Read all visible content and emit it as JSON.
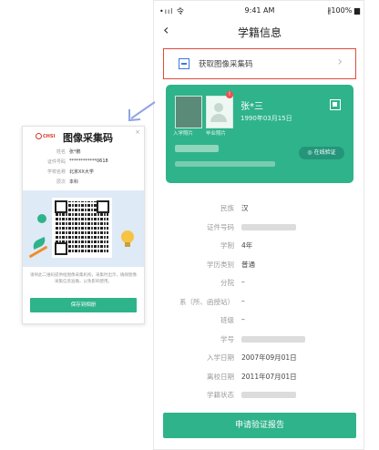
{
  "status_bar": {
    "signal": "•ııl 令",
    "time": "9:41 AM",
    "battery": "∦100% ▆"
  },
  "nav": {
    "back_icon": "chevron-left-icon",
    "title": "学籍信息"
  },
  "collect_banner": {
    "label": "获取图像采集码",
    "icon": "qr-scan-icon",
    "chevron_icon": "chevron-right-icon"
  },
  "student_card": {
    "name": "张*三",
    "birth": "1990年03月15日",
    "photo1_label": "入学照片",
    "photo2_label": "毕业照片",
    "badge": "!",
    "verify_label": "◎ 在线验证"
  },
  "details": [
    {
      "key": "民族",
      "value": "汉"
    },
    {
      "key": "证件号码",
      "value": ""
    },
    {
      "key": "学制",
      "value": "4年"
    },
    {
      "key": "学历类别",
      "value": "普通"
    },
    {
      "key": "分院",
      "value": "–"
    },
    {
      "key": "系（所、函授站）",
      "value": "–"
    },
    {
      "key": "班级",
      "value": "–"
    },
    {
      "key": "学号",
      "value": ""
    },
    {
      "key": "入学日期",
      "value": "2007年09月01日"
    },
    {
      "key": "离校日期",
      "value": "2011年07月01日"
    },
    {
      "key": "学籍状态",
      "value": ""
    }
  ],
  "submit_button": "申请验证报告",
  "popup": {
    "brand": "CHSI",
    "title": "图像采集码",
    "close": "×",
    "info": [
      {
        "key": "姓名",
        "value": "张*鹏"
      },
      {
        "key": "证件号码",
        "value": "************0618"
      },
      {
        "key": "学校名称",
        "value": "北京XX大学"
      },
      {
        "key": "层次",
        "value": "本科"
      }
    ],
    "tip": "请将此二维码提供给图像采集机构，采集时出示，确保图像采集信息准确，以免影响使用。",
    "button": "保存到相册"
  },
  "colors": {
    "accent": "#2fb38a",
    "highlight": "#e24a3b",
    "arrow": "#8fa3e6"
  }
}
